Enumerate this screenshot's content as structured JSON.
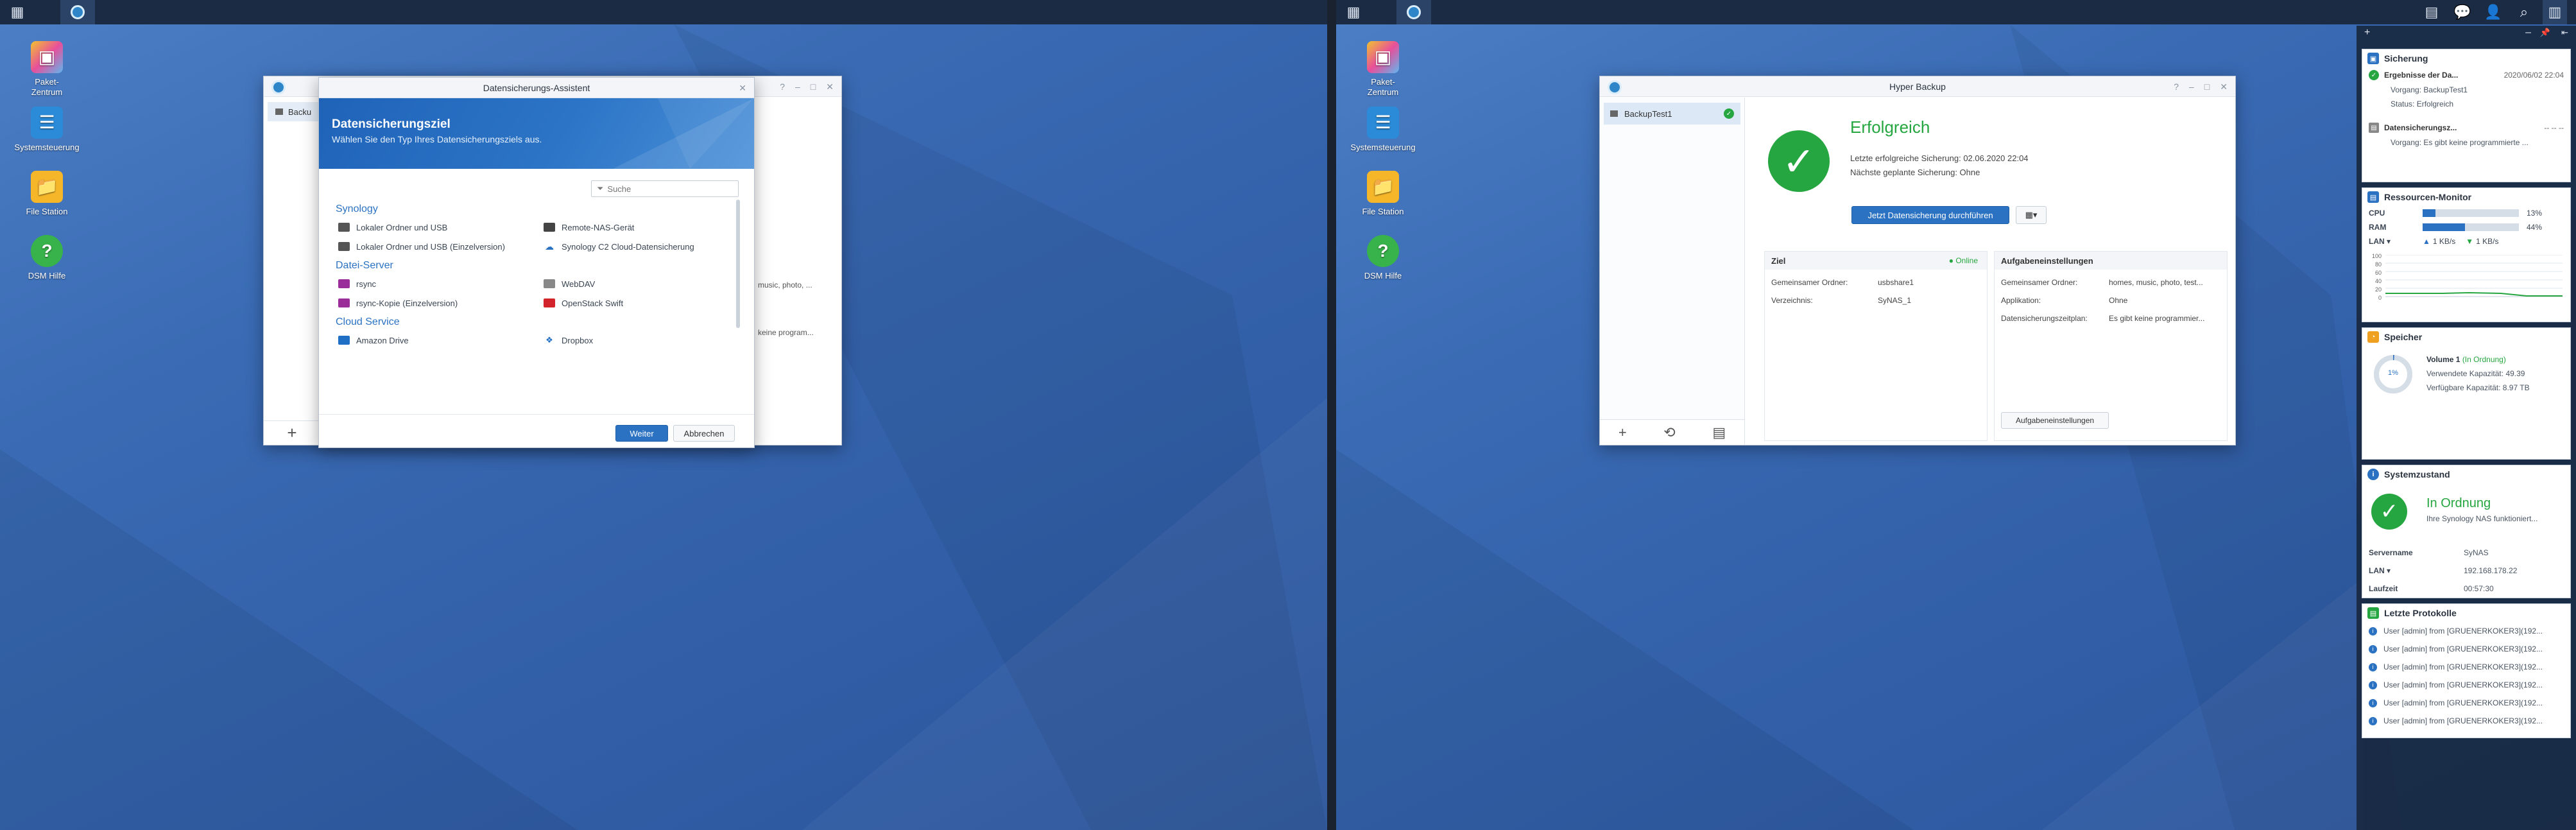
{
  "desktop": {
    "icons": [
      {
        "label_1": "Paket-",
        "label_2": "Zentrum",
        "icon": "package-center-icon"
      },
      {
        "label_1": "Systemsteuerung",
        "icon": "control-panel-icon"
      },
      {
        "label_1": "File Station",
        "icon": "file-station-icon"
      },
      {
        "label_1": "DSM Hilfe",
        "icon": "help-icon"
      }
    ]
  },
  "taskbar": {
    "main_menu_icon": "grid-icon",
    "app_icon": "hyper-backup-icon"
  },
  "wizard": {
    "title": "Datensicherungs-Assistent",
    "banner_title": "Datensicherungsziel",
    "banner_subtitle": "Wählen Sie den Typ Ihres Datensicherungsziels aus.",
    "search_placeholder": "Suche",
    "sections": [
      {
        "title": "Synology",
        "items": [
          "Lokaler Ordner und USB",
          "Remote-NAS-Gerät",
          "Lokaler Ordner und USB (Einzelversion)",
          "Synology C2 Cloud-Datensicherung"
        ]
      },
      {
        "title": "Datei-Server",
        "items": [
          "rsync",
          "WebDAV",
          "rsync-Kopie (Einzelversion)",
          "OpenStack Swift"
        ]
      },
      {
        "title": "Cloud Service",
        "items": [
          "Amazon Drive",
          "Dropbox"
        ]
      }
    ],
    "next_label": "Weiter",
    "cancel_label": "Abbrechen"
  },
  "bg_window": {
    "task_label": "Backu",
    "text_1": "music, photo, ...",
    "text_2": "keine program..."
  },
  "hyper_backup": {
    "title": "Hyper Backup",
    "task": "BackupTest1",
    "status_title": "Erfolgreich",
    "last_backup": "Letzte erfolgreiche Sicherung: 02.06.2020 22:04",
    "next_backup": "Nächste geplante Sicherung: Ohne",
    "backup_now": "Jetzt Datensicherung durchführen",
    "target": {
      "header": "Ziel",
      "status": "Online",
      "rows": [
        {
          "label": "Gemeinsamer Ordner:",
          "value": "usbshare1"
        },
        {
          "label": "Verzeichnis:",
          "value": "SyNAS_1"
        }
      ]
    },
    "settings": {
      "header": "Aufgabeneinstellungen",
      "rows": [
        {
          "label": "Gemeinsamer Ordner:",
          "value": "homes, music, photo, test..."
        },
        {
          "label": "Applikation:",
          "value": "Ohne"
        },
        {
          "label": "Datensicherungszeitplan:",
          "value": "Es gibt keine programmier..."
        }
      ],
      "button": "Aufgabeneinstellungen"
    }
  },
  "widgets": {
    "backup": {
      "title": "Sicherung",
      "item1_title": "Ergebnisse der Da...",
      "item1_time": "2020/06/02 22:04",
      "item1_line1": "Vorgang: BackupTest1",
      "item1_line2": "Status: Erfolgreich",
      "item2_title": "Datensicherungsz...",
      "item2_time": "-- -- --",
      "item2_line1": "Vorgang: Es gibt keine programmierte ..."
    },
    "resource": {
      "title": "Ressourcen-Monitor",
      "cpu_label": "CPU",
      "cpu_value": "13%",
      "cpu_fraction": 0.13,
      "ram_label": "RAM",
      "ram_value": "44%",
      "ram_fraction": 0.44,
      "lan_label": "LAN ▾",
      "lan_up": "1 KB/s",
      "lan_down": "1 KB/s",
      "chart_ticks": [
        "100",
        "80",
        "60",
        "40",
        "20",
        "0"
      ]
    },
    "storage": {
      "title": "Speicher",
      "volume": "Volume 1",
      "volume_status": "(In Ordnung)",
      "used_label": "Verwendete Kapazität:",
      "used_value": "49.39",
      "free_label": "Verfügbare Kapazität:",
      "free_value": "8.97 TB",
      "gauge_value": "1%",
      "gauge_fraction": 0.01
    },
    "health": {
      "title": "Systemzustand",
      "status": "In Ordnung",
      "status_sub": "Ihre Synology NAS funktioniert...",
      "rows": [
        {
          "label": "Servername",
          "value": "SyNAS"
        },
        {
          "label": "LAN ▾",
          "value": "192.168.178.22"
        },
        {
          "label": "Laufzeit",
          "value": "00:57:30"
        }
      ]
    },
    "logs": {
      "title": "Letzte Protokolle",
      "rows": [
        "User [admin] from [GRUENERKOKER3](192...",
        "User [admin] from [GRUENERKOKER3](192...",
        "User [admin] from [GRUENERKOKER3](192...",
        "User [admin] from [GRUENERKOKER3](192...",
        "User [admin] from [GRUENERKOKER3](192...",
        "User [admin] from [GRUENERKOKER3](192..."
      ]
    }
  },
  "colors": {
    "accent": "#2b72c2",
    "success": "#26a640",
    "taskbar": "#1b2b44"
  }
}
